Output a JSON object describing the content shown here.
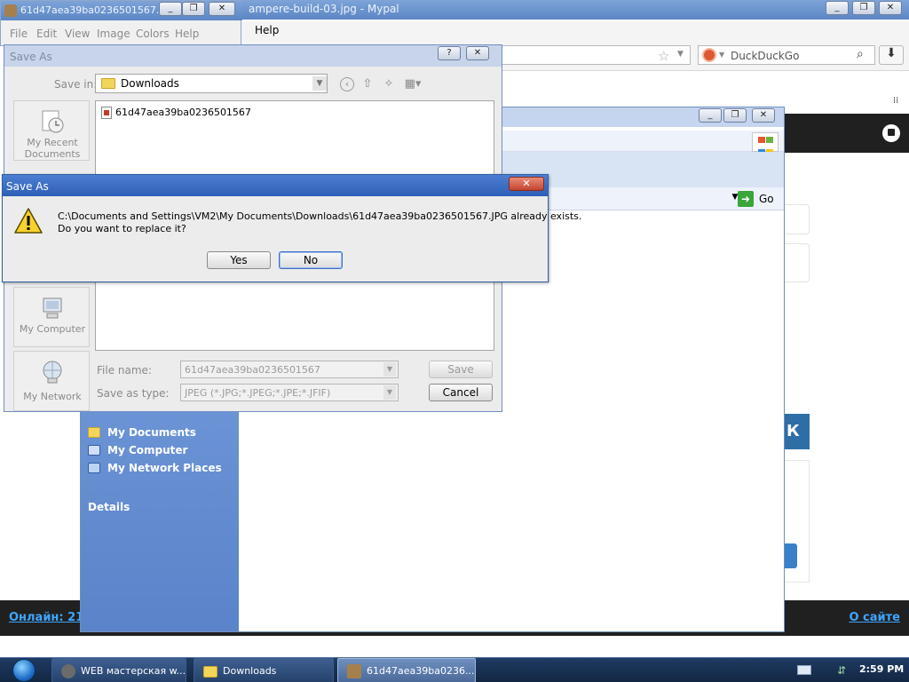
{
  "browser": {
    "title": "ampere-build-03.jpg - Mypal",
    "menu_help": "Help",
    "search_engine": "DuckDuckGo",
    "footer_online": "Онлайн: 21",
    "footer_about": "О сайте",
    "banner_letter": "К"
  },
  "paint": {
    "title": "61d47aea39ba0236501567...",
    "menus": [
      "File",
      "Edit",
      "View",
      "Image",
      "Colors",
      "Help"
    ]
  },
  "explorer": {
    "go_label": "Go",
    "left_pane": {
      "items": [
        "My Documents",
        "My Computer",
        "My Network Places"
      ],
      "details_label": "Details"
    }
  },
  "saveas": {
    "title": "Save As",
    "save_in_label": "Save in:",
    "save_in_value": "Downloads",
    "places": [
      "My Recent Documents",
      "My Computer",
      "My Network"
    ],
    "file_item": "61d47aea39ba0236501567",
    "file_name_label": "File name:",
    "file_name_value": "61d47aea39ba0236501567",
    "save_type_label": "Save as type:",
    "save_type_value": "JPEG (*.JPG;*.JPEG;*.JPE;*.JFIF)",
    "save_button": "Save",
    "cancel_button": "Cancel",
    "help_button": "?",
    "close_button": "✕"
  },
  "confirm": {
    "title": "Save As",
    "message_line1": "C:\\Documents and Settings\\VM2\\My Documents\\Downloads\\61d47aea39ba0236501567.JPG already exists.",
    "message_line2": "Do you want to replace it?",
    "yes_button": "Yes",
    "no_button": "No",
    "close_button": "✕"
  },
  "taskbar": {
    "tasks": [
      {
        "label": "WEB мастерская w...",
        "icon": "browser-icon"
      },
      {
        "label": "Downloads",
        "icon": "folder-icon"
      },
      {
        "label": "61d47aea39ba0236...",
        "icon": "paint-icon"
      }
    ],
    "clock": "2:59 PM"
  },
  "colors": {
    "titlebar_active": "#2d5fb6",
    "taskbar": "#1f3b63",
    "explorer_pane": "#5a83c9",
    "footer_link": "#3fa6ff"
  }
}
